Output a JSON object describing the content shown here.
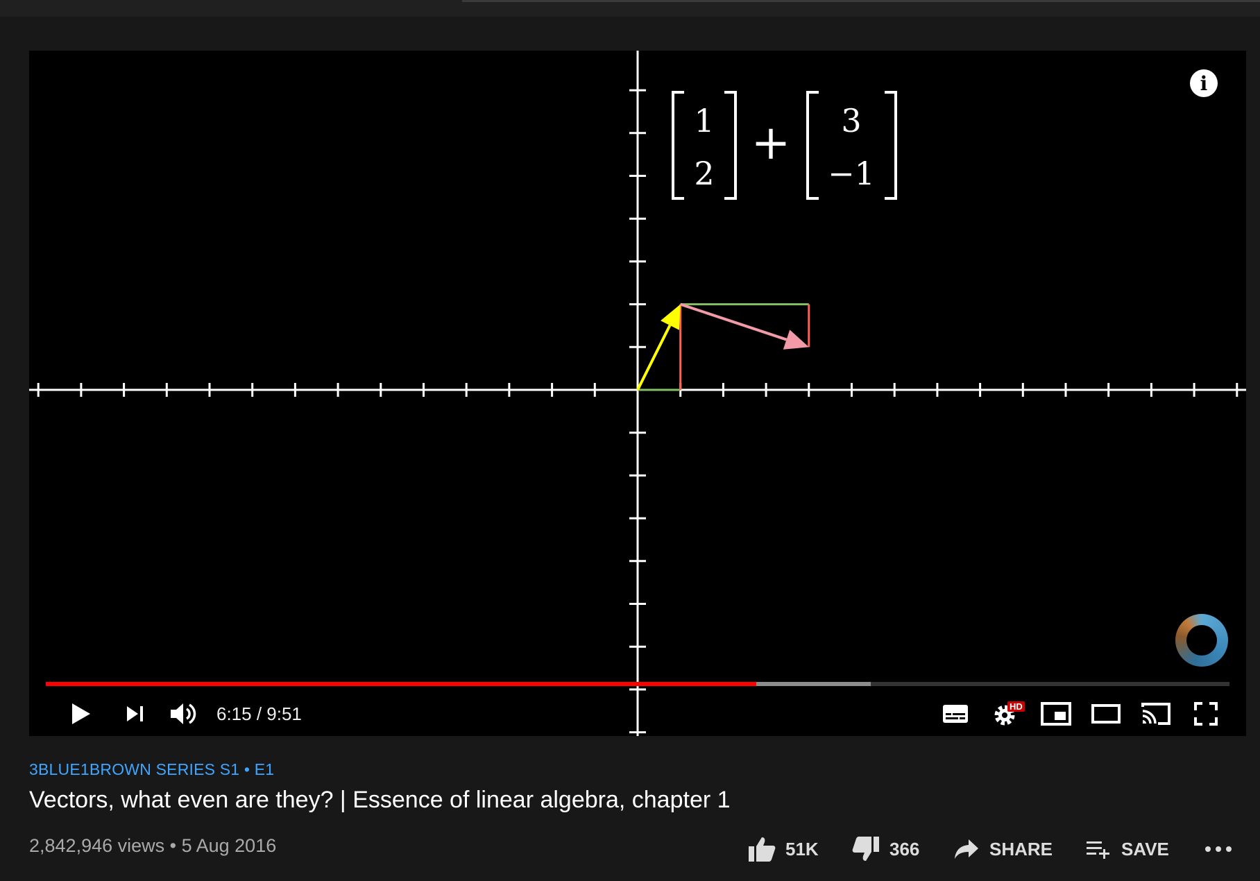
{
  "video": {
    "equation": {
      "vector_a": [
        "1",
        "2"
      ],
      "operator": "+",
      "vector_b": [
        "3",
        "−1"
      ]
    },
    "info_label": "i",
    "progress": {
      "played_fraction": 0.6,
      "buffered_fraction": 0.697
    },
    "time_display": "6:15 / 9:51"
  },
  "colors": {
    "vector_a": "#ffff00",
    "vector_b": "#f29aa7",
    "component_green": "#83c167",
    "component_red": "#fc6255",
    "progress_played": "#ff0000",
    "series_link": "#3ea6ff",
    "hd_badge": "#cc0000"
  },
  "icons": {
    "play": "play-icon",
    "next": "next-icon",
    "volume": "volume-icon",
    "subtitles": "subtitles-icon",
    "settings": "settings-icon",
    "miniplayer": "miniplayer-icon",
    "theater": "theater-icon",
    "cast": "cast-icon",
    "fullscreen": "fullscreen-icon"
  },
  "settings_badge": "HD",
  "series": "3BLUE1BROWN SERIES  S1 • E1",
  "title": "Vectors, what even are they? | Essence of linear algebra, chapter 1",
  "stats": "2,842,946 views • 5 Aug 2016",
  "actions": {
    "like": "51K",
    "dislike": "366",
    "share": "SHARE",
    "save": "SAVE"
  }
}
